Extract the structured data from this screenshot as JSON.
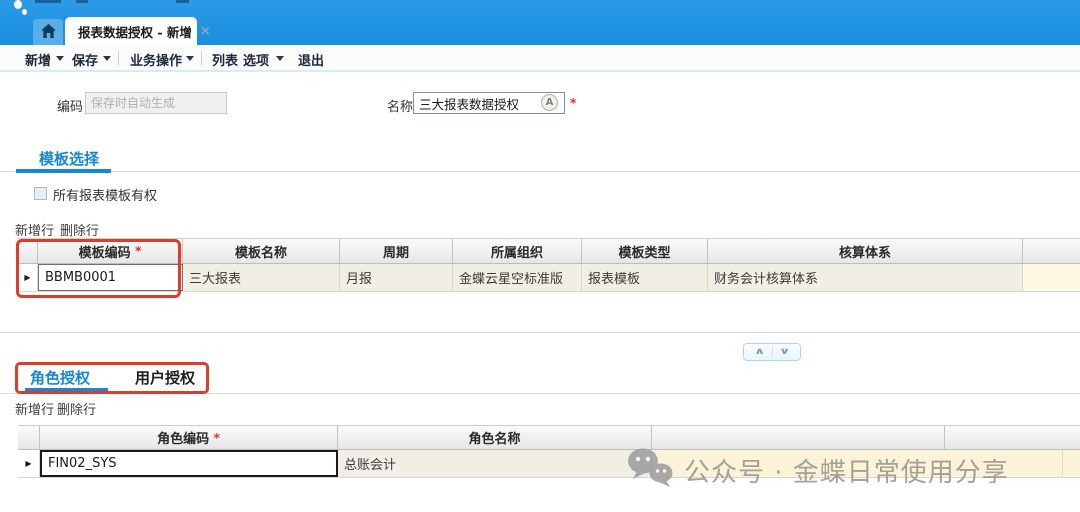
{
  "window": {
    "tab": {
      "title": "报表数据授权 - 新增",
      "close": "×"
    }
  },
  "menubar": {
    "items": [
      {
        "label": "新增"
      },
      {
        "label": "保存"
      },
      {
        "label": "业务操作"
      },
      {
        "label": "列表"
      },
      {
        "label": "选项"
      },
      {
        "label": "退出"
      }
    ]
  },
  "form": {
    "code": {
      "label": "编码",
      "placeholder": "保存时自动生成"
    },
    "name": {
      "label": "名称",
      "value": "三大报表数据授权",
      "required": "*",
      "locale_button": "A"
    }
  },
  "template_section": {
    "title": "模板选择",
    "checkbox_label": "所有报表模板有权",
    "toolbar": {
      "add": "新增行",
      "delete": "删除行"
    },
    "grid": {
      "row_marker": "▶",
      "required_marker": "*",
      "columns": [
        "模板编码",
        "模板名称",
        "周期",
        "所属组织",
        "模板类型",
        "核算体系"
      ],
      "rows": [
        [
          "BBMB0001",
          "三大报表",
          "月报",
          "金蝶云星空标准版",
          "报表模板",
          "财务会计核算体系"
        ]
      ]
    }
  },
  "collapse_control": {
    "up": "∧",
    "down": "∨"
  },
  "auth_section": {
    "tabs": [
      {
        "label": "角色授权",
        "active": true
      },
      {
        "label": "用户授权",
        "active": false
      }
    ],
    "toolbar": {
      "add": "新增行",
      "delete": "删除行"
    },
    "grid": {
      "row_marker": "▶",
      "required_marker": "*",
      "columns": [
        "角色编码",
        "角色名称"
      ],
      "rows": [
        [
          "FIN02_SYS",
          "总账会计"
        ]
      ]
    }
  },
  "watermark": {
    "text": "公众号 · 金蝶日常使用分享"
  },
  "colors": {
    "topbar_blue": "#1e93e4",
    "heading_blue": "#1787d0",
    "annotation_red": "#e03c2a",
    "required_red": "#e02a1a",
    "row_beige": "#f1eee5",
    "row_yellow": "#fdf8e2"
  }
}
